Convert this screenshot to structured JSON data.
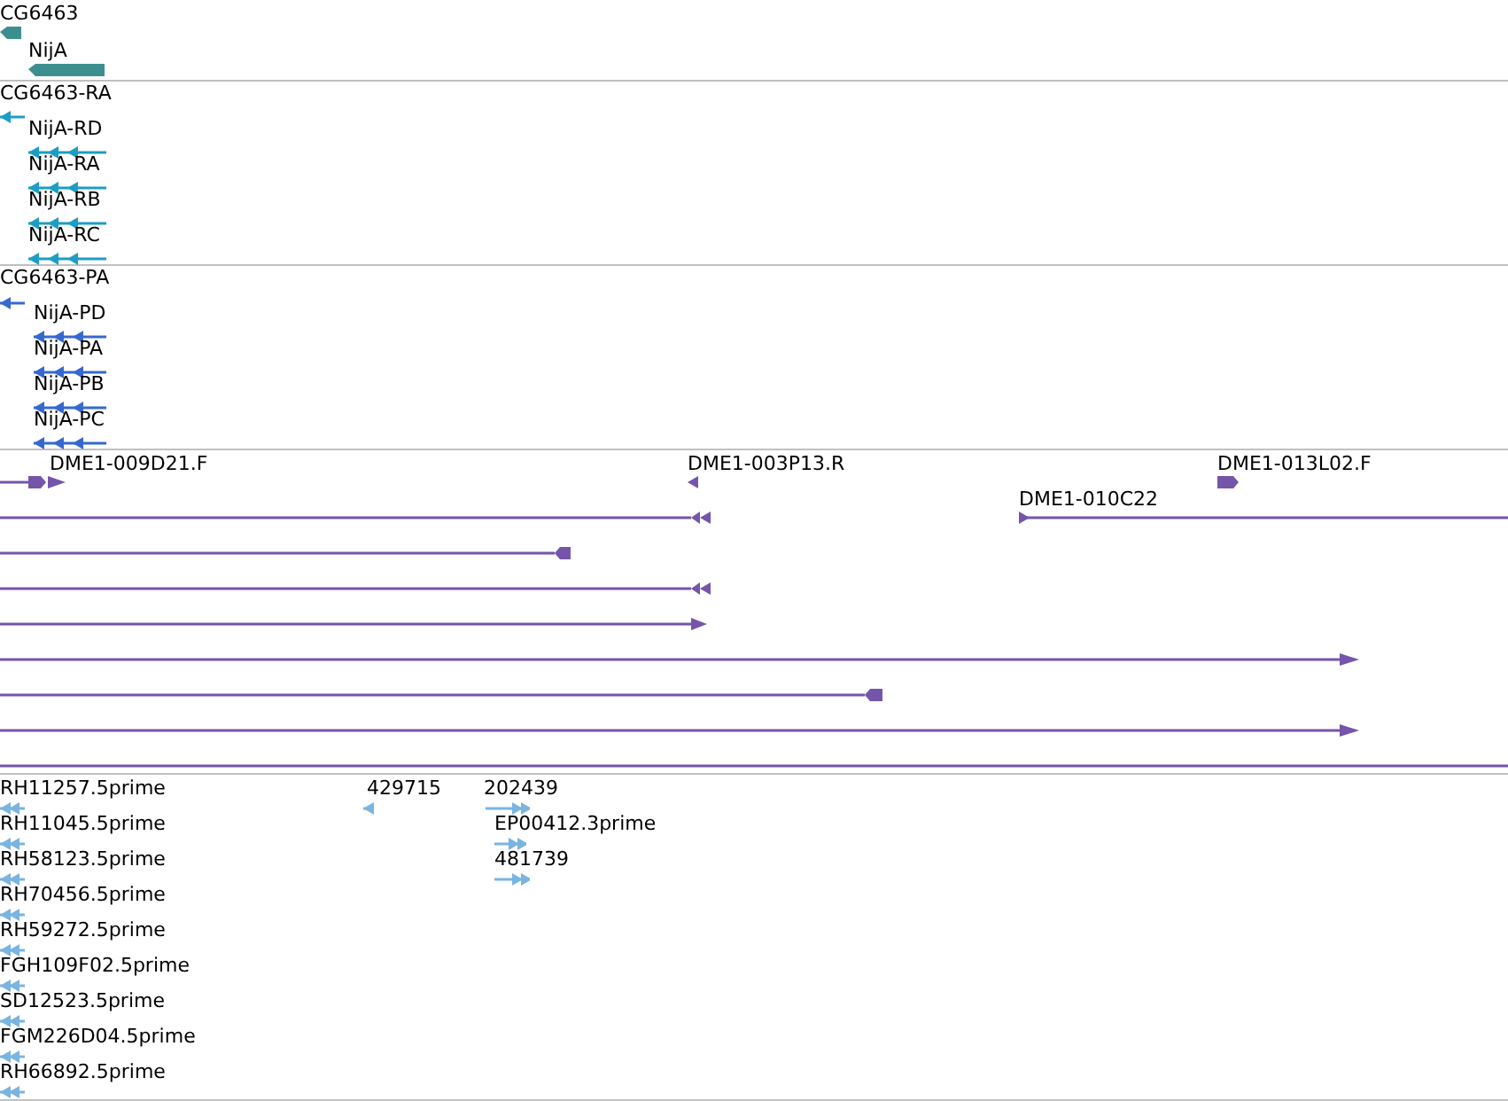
{
  "tracks": [
    {
      "kind": "gene",
      "color": "#3d8f8f",
      "features": [
        {
          "label": "CG6463",
          "reverse": true
        },
        {
          "label": "NijA",
          "reverse": true
        }
      ]
    },
    {
      "kind": "transcript",
      "color": "#1c9ec4",
      "features": [
        {
          "label": "CG6463-RA",
          "reverse": true
        },
        {
          "label": "NijA-RD",
          "reverse": true
        },
        {
          "label": "NijA-RA",
          "reverse": true
        },
        {
          "label": "NijA-RB",
          "reverse": true
        },
        {
          "label": "NijA-RC",
          "reverse": true
        }
      ]
    },
    {
      "kind": "transcript",
      "color": "#3668d0",
      "features": [
        {
          "label": "CG6463-PA",
          "reverse": true
        },
        {
          "label": "NijA-PD",
          "reverse": true
        },
        {
          "label": "NijA-PA",
          "reverse": true
        },
        {
          "label": "NijA-PB",
          "reverse": true
        },
        {
          "label": "NijA-PC",
          "reverse": true
        }
      ]
    },
    {
      "kind": "alignment",
      "color": "#7555aa",
      "features": [
        {
          "label": "DME1-009D21.F",
          "reverse": false
        },
        {
          "label": "DME1-003P13.R",
          "reverse": true
        },
        {
          "label": "DME1-013L02.F",
          "reverse": false
        },
        {
          "label": "DME1-010C22",
          "reverse": false
        }
      ]
    },
    {
      "kind": "est",
      "color": "#7ab4e0",
      "features": [
        {
          "label": "RH11257.5prime",
          "reverse": true
        },
        {
          "label": "RH11045.5prime",
          "reverse": true
        },
        {
          "label": "RH58123.5prime",
          "reverse": true
        },
        {
          "label": "RH70456.5prime",
          "reverse": true
        },
        {
          "label": "RH59272.5prime",
          "reverse": true
        },
        {
          "label": "FGH109F02.5prime",
          "reverse": true
        },
        {
          "label": "SD12523.5prime",
          "reverse": true
        },
        {
          "label": "FGM226D04.5prime",
          "reverse": true
        },
        {
          "label": "RH66892.5prime",
          "reverse": true
        },
        {
          "label": "429715",
          "reverse": true
        },
        {
          "label": "202439",
          "reverse": false
        },
        {
          "label": "EP00412.3prime",
          "reverse": false
        },
        {
          "label": "481739",
          "reverse": false
        }
      ]
    }
  ]
}
